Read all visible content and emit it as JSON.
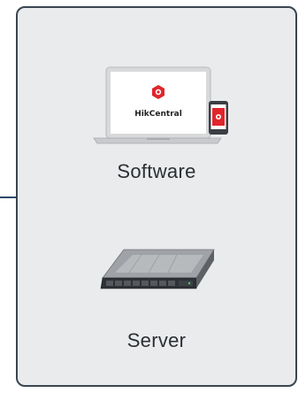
{
  "panel": {
    "software": {
      "brand": "HikCentral",
      "label": "Software",
      "icon": "laptop-with-tablet-icon",
      "accent_color": "#e0252b"
    },
    "server": {
      "label": "Server",
      "icon": "rack-server-icon"
    }
  },
  "colors": {
    "panel_background": "#eaebed",
    "panel_border": "#3a4650",
    "connector": "#2f4a6d"
  }
}
